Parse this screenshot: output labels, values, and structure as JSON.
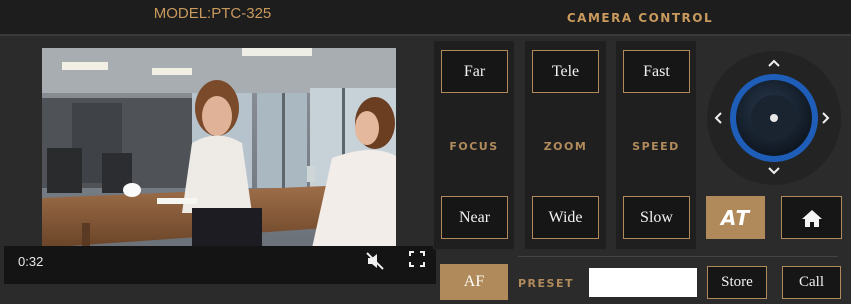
{
  "header": {
    "model_title": "MODEL:PTC-325",
    "camera_title": "CAMERA CONTROL"
  },
  "video": {
    "time": "0:32"
  },
  "focus": {
    "far_label": "Far",
    "near_label": "Near",
    "label": "FOCUS"
  },
  "zoom": {
    "tele_label": "Tele",
    "wide_label": "Wide",
    "label": "ZOOM"
  },
  "speed": {
    "fast_label": "Fast",
    "slow_label": "Slow",
    "label": "SPEED"
  },
  "af_label": "AF",
  "at_label": "AT",
  "preset": {
    "label": "PRESET",
    "value": "",
    "store_label": "Store",
    "call_label": "Call"
  },
  "icons": {
    "mute": "mute-icon",
    "fullscreen": "fullscreen-icon",
    "home": "home-icon",
    "up": "chevron-up-icon",
    "down": "chevron-down-icon",
    "left": "chevron-left-icon",
    "right": "chevron-right-icon"
  },
  "colors": {
    "accent": "#b08a5a",
    "joystick_ring": "#1f5eb8",
    "background": "#2b2b2b"
  }
}
